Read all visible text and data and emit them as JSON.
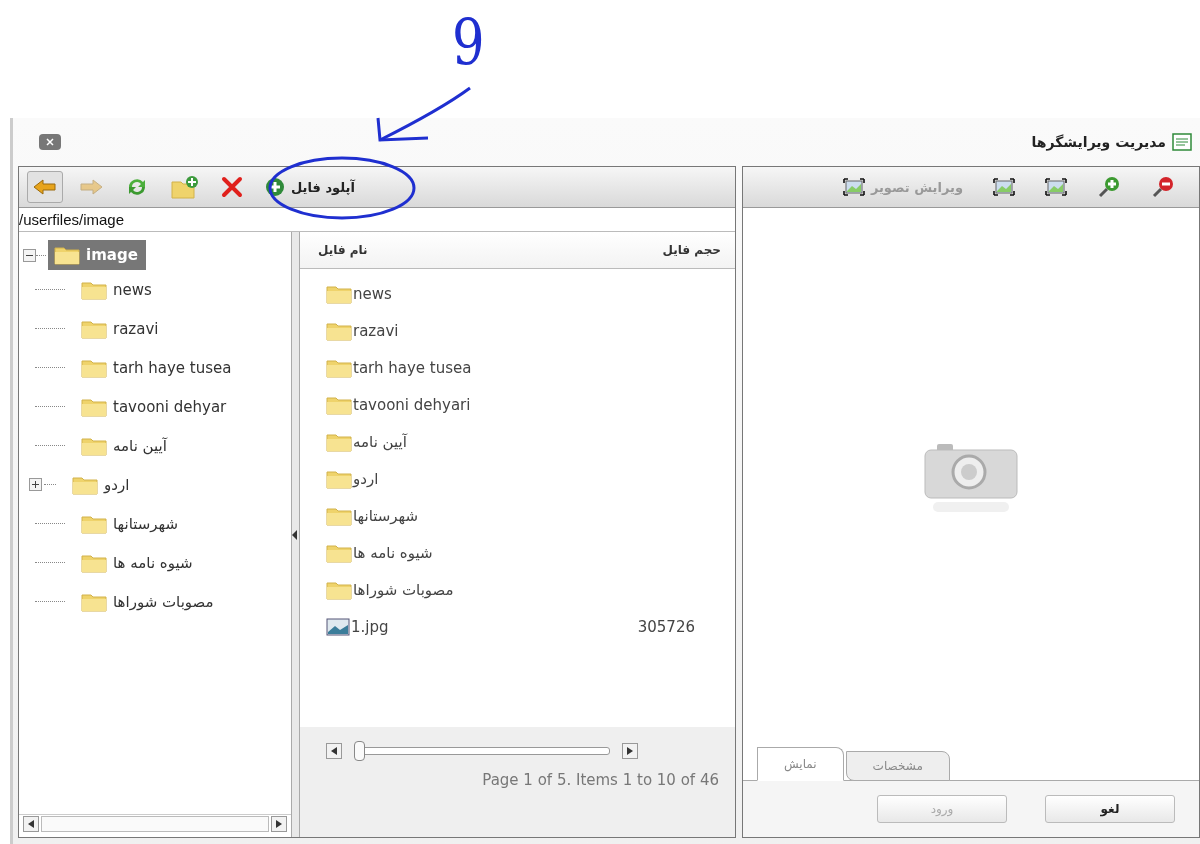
{
  "annotation": {
    "label": "9"
  },
  "window": {
    "title": "مدیریت ویرایشگرها"
  },
  "browser": {
    "toolbar": [
      {
        "kind": "back",
        "pressed": true,
        "disabled": false
      },
      {
        "kind": "forward",
        "pressed": false,
        "disabled": true
      },
      {
        "kind": "refresh",
        "pressed": false,
        "disabled": false
      },
      {
        "kind": "new-folder",
        "pressed": false,
        "disabled": false
      },
      {
        "kind": "delete",
        "pressed": false,
        "disabled": false
      },
      {
        "kind": "upload",
        "label": "آپلود فایل",
        "pressed": false,
        "disabled": false
      }
    ],
    "path": "/userfiles/image",
    "tree": {
      "label": "image",
      "selected": true,
      "expanded": true,
      "children": [
        {
          "label": "news",
          "expandable": false
        },
        {
          "label": "razavi",
          "expandable": false
        },
        {
          "label": "tarh haye tusea",
          "expandable": false
        },
        {
          "label": "tavooni dehyar",
          "expandable": false
        },
        {
          "label": "آیین نامه",
          "expandable": false
        },
        {
          "label": "اردو",
          "expandable": true
        },
        {
          "label": "شهرستانها",
          "expandable": false
        },
        {
          "label": "شیوه نامه ها",
          "expandable": false
        },
        {
          "label": "مصوبات شوراها",
          "expandable": false
        }
      ]
    },
    "files": {
      "columns": [
        "حجم فایل",
        "نام فایل"
      ],
      "rows": [
        {
          "kind": "folder",
          "name": "news"
        },
        {
          "kind": "folder",
          "name": "razavi"
        },
        {
          "kind": "folder",
          "name": "tarh haye tusea"
        },
        {
          "kind": "folder",
          "name": "tavooni dehyari"
        },
        {
          "kind": "folder",
          "name": "آیین نامه"
        },
        {
          "kind": "folder",
          "name": "اردو"
        },
        {
          "kind": "folder",
          "name": "شهرستانها"
        },
        {
          "kind": "folder",
          "name": "شیوه نامه ها"
        },
        {
          "kind": "folder",
          "name": "مصوبات شوراها"
        },
        {
          "kind": "image",
          "name": "1.jpg",
          "size": "305726"
        }
      ]
    },
    "pager": {
      "level": 0,
      "status": "Page 1 of 5. Items 1 to 10 of 46"
    }
  },
  "preview": {
    "toolbar": [
      {
        "kind": "zoom-out",
        "disabled": false
      },
      {
        "kind": "zoom-in",
        "disabled": false
      },
      {
        "kind": "fit",
        "disabled": false
      },
      {
        "kind": "actual-size",
        "disabled": false
      },
      {
        "kind": "edit",
        "label": "ویرایش تصویر",
        "disabled": true
      }
    ],
    "tabs": [
      {
        "label": "مشخصات",
        "selected": false
      },
      {
        "label": "نمایش",
        "selected": true
      }
    ],
    "buttons": [
      {
        "label": "لغو",
        "disabled": false
      },
      {
        "label": "ورود",
        "disabled": true
      }
    ]
  }
}
